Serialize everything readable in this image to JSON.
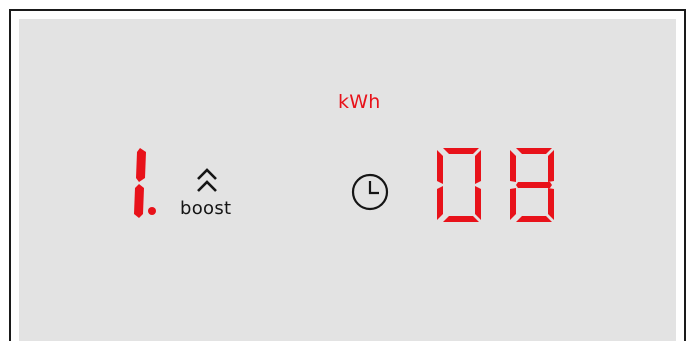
{
  "display": {
    "unit_label": "kWh",
    "power_level": "1.",
    "boost_label": "boost",
    "timer_value": "08",
    "accent_color": "#e8121a",
    "icons": [
      "boost-chevron-icon",
      "clock-icon"
    ]
  }
}
